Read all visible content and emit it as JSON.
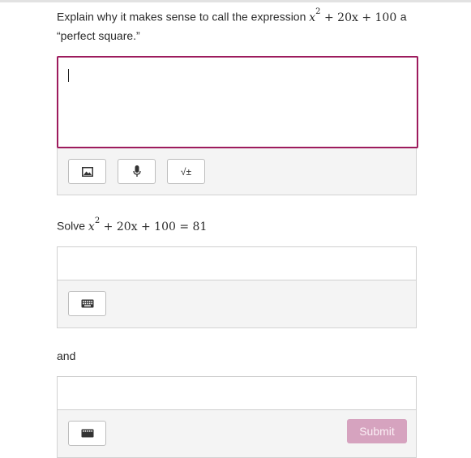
{
  "question1": {
    "prefix": "Explain why it makes sense to call the expression",
    "expr": {
      "var": "x",
      "exp": "2",
      "rest": "+ 20x + 100"
    },
    "suffix": "a",
    "line2": "“perfect square.”"
  },
  "toolbar": {
    "image_icon": "image-icon",
    "mic_icon": "microphone-icon",
    "math_label": "√±"
  },
  "question2": {
    "prefix": "Solve",
    "expr": {
      "var": "x",
      "exp": "2",
      "rest": "+ 20x + 100 = 81"
    }
  },
  "connector": "and",
  "keyboard_icon": "keyboard-icon",
  "submit_label": "Submit",
  "colors": {
    "focus_border": "#9d1b5d",
    "submit_bg": "#d6a3bf"
  }
}
